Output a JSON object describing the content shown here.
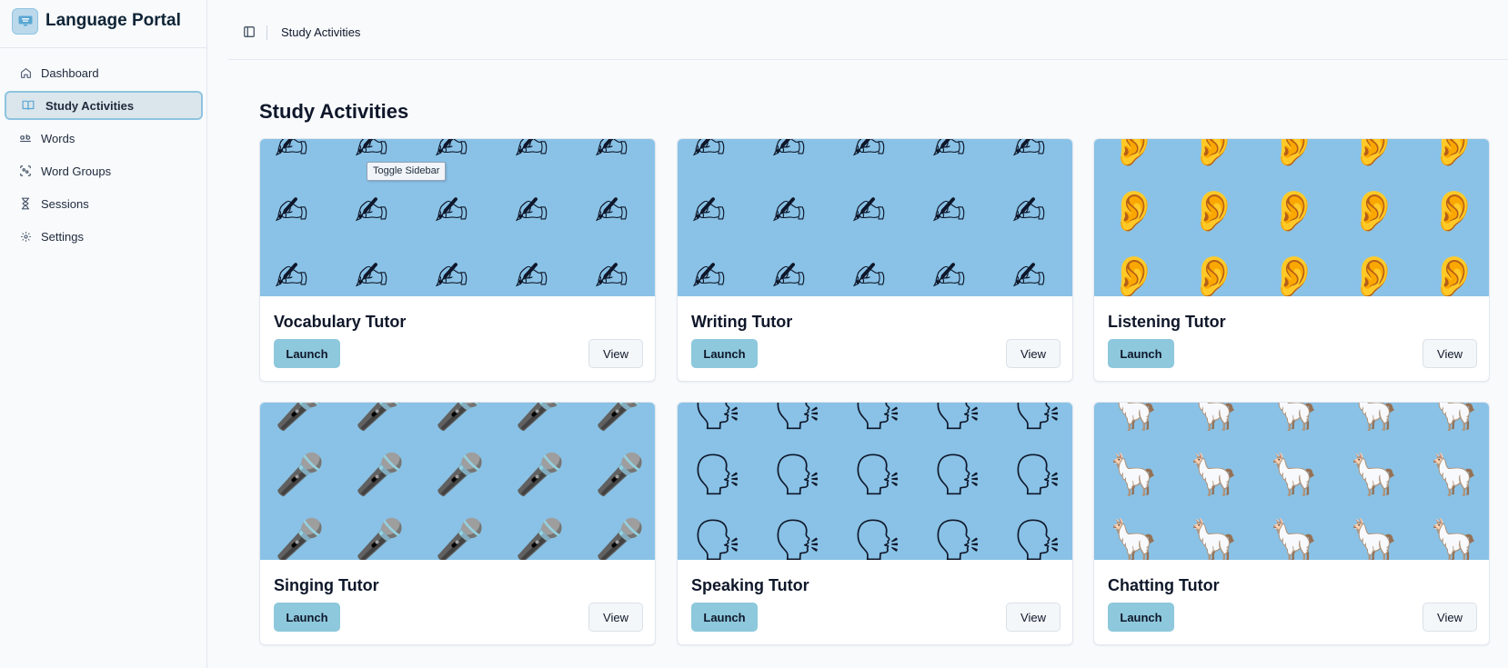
{
  "app": {
    "title": "Language Portal"
  },
  "header": {
    "breadcrumb": "Study Activities",
    "toggle_tooltip": "Toggle Sidebar"
  },
  "sidebar": {
    "items": [
      {
        "label": "Dashboard",
        "icon": "home-icon",
        "active": false
      },
      {
        "label": "Study Activities",
        "icon": "book-open-icon",
        "active": true
      },
      {
        "label": "Words",
        "icon": "whole-word-icon",
        "active": false
      },
      {
        "label": "Word Groups",
        "icon": "group-icon",
        "active": false
      },
      {
        "label": "Sessions",
        "icon": "hourglass-icon",
        "active": false
      },
      {
        "label": "Settings",
        "icon": "gear-icon",
        "active": false
      }
    ]
  },
  "main": {
    "title": "Study Activities",
    "launch_label": "Launch",
    "view_label": "View",
    "activities": [
      {
        "title": "Vocabulary Tutor",
        "image": "writing-hand-emoji-grid",
        "emoji": "✍"
      },
      {
        "title": "Writing Tutor",
        "image": "writing-hand-emoji-grid",
        "emoji": "✍"
      },
      {
        "title": "Listening Tutor",
        "image": "ear-emoji-grid",
        "emoji": "👂"
      },
      {
        "title": "Singing Tutor",
        "image": "singer-emoji-grid",
        "emoji": "🎤"
      },
      {
        "title": "Speaking Tutor",
        "image": "speaking-head-emoji-grid",
        "emoji": "🗣"
      },
      {
        "title": "Chatting Tutor",
        "image": "llama-emoji-grid",
        "emoji": "🦙"
      }
    ]
  },
  "colors": {
    "card_image_bg": "#89c2e6",
    "launch_bg": "#8ec8dc",
    "active_border": "#8ec4e0"
  }
}
